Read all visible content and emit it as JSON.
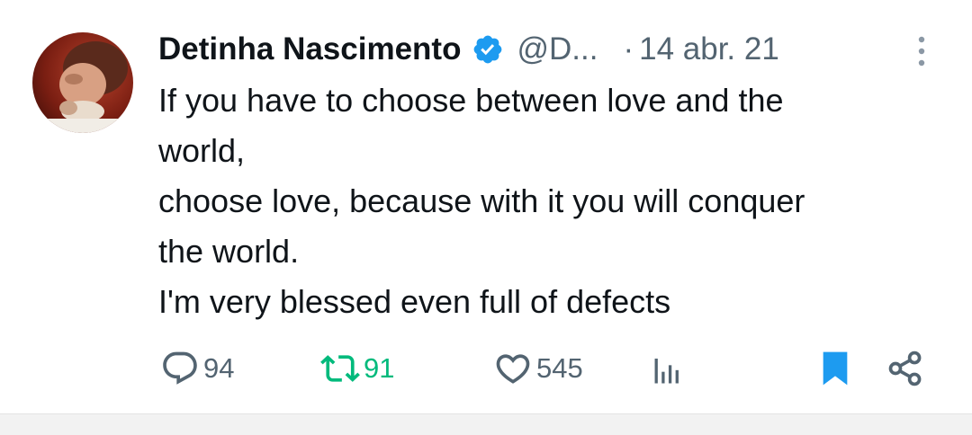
{
  "tweet": {
    "author_name": "Detinha Nascimento",
    "handle": "@D...",
    "separator": "·",
    "date": "14 abr. 21",
    "lines": [
      "If you have to choose between love and the",
      "world,",
      "choose love, because with it you will conquer",
      "the world.",
      "I'm very blessed even full of defects"
    ]
  },
  "actions": {
    "replies": "94",
    "retweets": "91",
    "likes": "545"
  },
  "colors": {
    "text": "#0f1419",
    "secondary": "#536471",
    "verified_blue": "#1d9bf0",
    "retweet_green": "#00ba7c",
    "bookmark_blue": "#1d9bf0"
  },
  "icons": {
    "verified": "verified-badge-icon",
    "more": "more-vertical-icon",
    "reply": "reply-bubble-icon",
    "retweet": "retweet-icon",
    "like": "heart-icon",
    "views": "views-bar-chart-icon",
    "bookmark": "bookmark-icon",
    "share": "share-icon"
  }
}
